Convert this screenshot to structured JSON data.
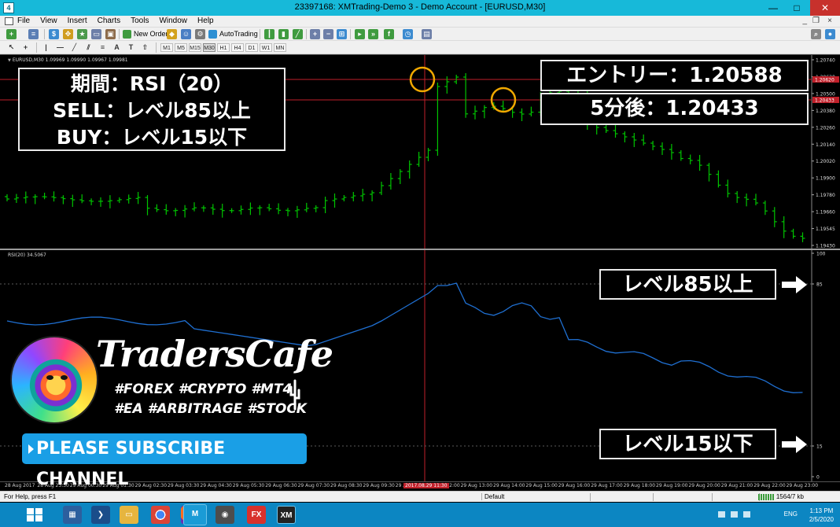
{
  "window": {
    "title": "23397168: XMTrading-Demo 3 - Demo Account - [EURUSD,M30]",
    "minimize": "—",
    "maximize": "□",
    "close": "✕",
    "app_icon": "4"
  },
  "menu": {
    "items": [
      "File",
      "View",
      "Insert",
      "Charts",
      "Tools",
      "Window",
      "Help"
    ],
    "mdi_min": "_",
    "mdi_restore": "❐",
    "mdi_close": "×"
  },
  "toolbar": {
    "new_order": "New Order",
    "auto_trading": "AutoTrading",
    "timeframes": [
      "M1",
      "M5",
      "M15",
      "M30",
      "H1",
      "H4",
      "D1",
      "W1",
      "MN"
    ],
    "active_timeframe": "M30"
  },
  "chart": {
    "symbol_label": "EURUSD,M30  1.09969 1.09990 1.09967 1.09981",
    "rsi_label": "RSI(20) 34.5067",
    "price_axis": [
      "1.20740",
      "1.20620",
      "1.20500",
      "1.20380",
      "1.20260",
      "1.20140",
      "1.20020",
      "1.19900",
      "1.19780",
      "1.19660",
      "1.19545",
      "1.19430"
    ],
    "price_tags": [
      "1.20620",
      "1.20433"
    ],
    "rsi_axis": [
      "100",
      "85",
      "15",
      "0"
    ],
    "date_axis": [
      "28 Aug 2017",
      "28 Aug 23:30",
      "29 Aug 00:30",
      "29 Aug 01:30",
      "29 Aug 02:30",
      "29 Aug 03:30",
      "29 Aug 04:30",
      "29 Aug 05:30",
      "29 Aug 06:30",
      "29 Aug 07:30",
      "29 Aug 08:30",
      "29 Aug 09:30",
      "29 Aug 10:30",
      "29 Aug 12:00",
      "29 Aug 13:00",
      "29 Aug 14:00",
      "29 Aug 15:00",
      "29 Aug 16:00",
      "29 Aug 17:00",
      "29 Aug 18:00",
      "29 Aug 19:00",
      "29 Aug 20:00",
      "29 Aug 21:00",
      "29 Aug 22:00",
      "29 Aug 23:00"
    ],
    "highlighted_date": "2017.08.29 11:30",
    "colors": {
      "bar": "#00c400",
      "rsi_line": "#1f6fd1",
      "crosshair": "#c0202a",
      "entry_line": "#c0202a",
      "circle": "#f0a800",
      "grid": "#5a5a5a"
    }
  },
  "overlay": {
    "period_lines": [
      "期間：RSI（20）",
      "SELL：レベル85以上",
      "BUY：レベル15以下"
    ],
    "entry": "エントリー：1.20588",
    "after5": "5分後：1.20433",
    "level85": "レベル85以上",
    "level15": "レベル15以下"
  },
  "brand": {
    "name": "TradersCafe",
    "tags_line1": "#FOREX #CRYPTO #MT4",
    "tags_line2": "#EA #ARBITRAGE #STOCK",
    "subscribe": "PLEASE SUBSCRIBE CHANNEL"
  },
  "status": {
    "help": "For Help, press F1",
    "profile": "Default",
    "connection": "1564/7 kb"
  },
  "taskbar": {
    "icons": [
      "server-manager-icon",
      "powershell-icon",
      "file-explorer-icon",
      "chrome-icon",
      "firefox-icon",
      "mt4-icon",
      "metaeditor-icon",
      "fx-icon",
      "xm-icon"
    ],
    "language": "ENG",
    "time": "1:13 PM",
    "date": "2/5/2020"
  }
}
